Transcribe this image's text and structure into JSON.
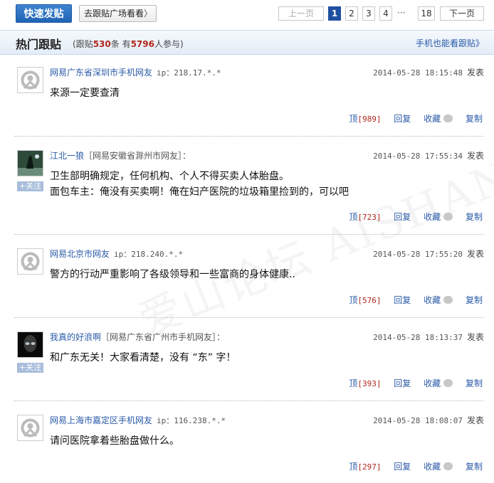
{
  "toolbar": {
    "post_button": "快速发贴",
    "plaza_button": "去跟贴广场看看",
    "plaza_chevron": "〉"
  },
  "pager": {
    "prev": "上一页",
    "pages": [
      "1",
      "2",
      "3",
      "4"
    ],
    "ellipsis": "···",
    "last": "18",
    "next": "下一页",
    "current": "1"
  },
  "header": {
    "title": "热门跟贴",
    "stats_prefix": "(跟贴",
    "post_count": "530",
    "stats_mid": "条  有",
    "participant_count": "5796",
    "stats_suffix": "人参与)",
    "mobile_link": "手机也能看跟贴》"
  },
  "watermark": "爱山论坛 AISHAN BBS",
  "posts": [
    {
      "user": "网易广东省深圳市手机网友",
      "from": "",
      "ip": "ip：218.17.*.*",
      "time": "2014-05-28 18:15:48",
      "publish": "发表",
      "content": [
        "来源一定要查清"
      ],
      "up_label": "顶",
      "up_count": "[989]",
      "reply": "回复",
      "favorite": "收藏",
      "copy": "复制",
      "follow": ""
    },
    {
      "user": "江北一狼",
      "from": "［网易安徽省滁州市网友］：",
      "ip": "",
      "time": "2014-05-28 17:55:34",
      "publish": "发表",
      "content": [
        "卫生部明确规定，任何机构、个人不得买卖人体胎盘。",
        "面包车主：俺没有买卖啊！俺在妇产医院的垃圾箱里捡到的，可以吧"
      ],
      "up_label": "顶",
      "up_count": "[723]",
      "reply": "回复",
      "favorite": "收藏",
      "copy": "复制",
      "follow": "+关注"
    },
    {
      "user": "网易北京市网友",
      "from": "",
      "ip": "ip：218.240.*.*",
      "time": "2014-05-28 17:55:20",
      "publish": "发表",
      "content": [
        "警方的行动严重影响了各级领导和一些富商的身体健康.."
      ],
      "up_label": "顶",
      "up_count": "[576]",
      "reply": "回复",
      "favorite": "收藏",
      "copy": "复制",
      "follow": ""
    },
    {
      "user": "我真的好浪啊",
      "from": "［网易广东省广州市手机网友］：",
      "ip": "",
      "time": "2014-05-28 18:13:37",
      "publish": "发表",
      "content": [
        "和广东无关！大家看清楚，没有 “东” 字！"
      ],
      "up_label": "顶",
      "up_count": "[393]",
      "reply": "回复",
      "favorite": "收藏",
      "copy": "复制",
      "follow": "+关注"
    },
    {
      "user": "网易上海市嘉定区手机网友",
      "from": "",
      "ip": "ip：116.238.*.*",
      "time": "2014-05-28 18:08:07",
      "publish": "发表",
      "content": [
        "请问医院拿着些胎盘做什么。"
      ],
      "up_label": "顶",
      "up_count": "[297]",
      "reply": "回复",
      "favorite": "收藏",
      "copy": "复制",
      "follow": ""
    }
  ]
}
